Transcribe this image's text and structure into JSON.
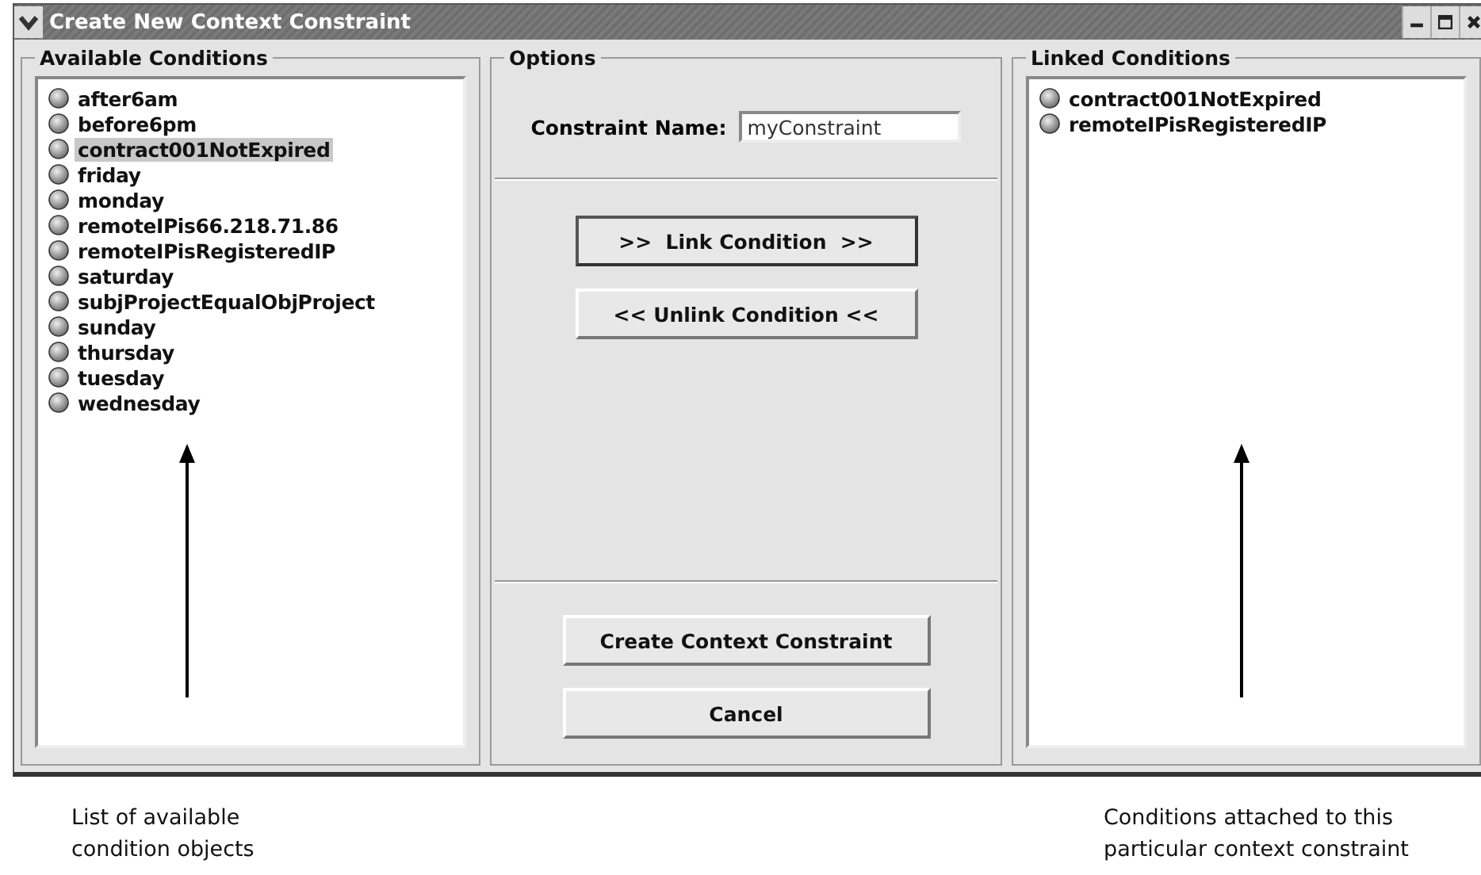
{
  "window": {
    "title": "Create New Context Constraint"
  },
  "available": {
    "title": "Available Conditions",
    "items": [
      {
        "label": "after6am",
        "selected": false
      },
      {
        "label": "before6pm",
        "selected": false
      },
      {
        "label": "contract001NotExpired",
        "selected": true
      },
      {
        "label": "friday",
        "selected": false
      },
      {
        "label": "monday",
        "selected": false
      },
      {
        "label": "remoteIPis66.218.71.86",
        "selected": false
      },
      {
        "label": "remoteIPisRegisteredIP",
        "selected": false
      },
      {
        "label": "saturday",
        "selected": false
      },
      {
        "label": "subjProjectEqualObjProject",
        "selected": false
      },
      {
        "label": "sunday",
        "selected": false
      },
      {
        "label": "thursday",
        "selected": false
      },
      {
        "label": "tuesday",
        "selected": false
      },
      {
        "label": "wednesday",
        "selected": false
      }
    ]
  },
  "options": {
    "title": "Options",
    "name_label": "Constraint Name:",
    "name_value": "myConstraint",
    "link_buttons": [
      {
        "label": ">>  Link Condition  >>",
        "focused": true
      },
      {
        "label": "<< Unlink Condition <<",
        "focused": false
      }
    ],
    "action_buttons": [
      {
        "label": "Create Context Constraint",
        "focused": false
      },
      {
        "label": "Cancel",
        "focused": false
      }
    ]
  },
  "linked": {
    "title": "Linked Conditions",
    "items": [
      {
        "label": "contract001NotExpired",
        "selected": false
      },
      {
        "label": "remoteIPisRegisteredIP",
        "selected": false
      }
    ]
  },
  "annotations": [
    "List of available condition objects",
    "Conditions attached to this particular context constraint"
  ]
}
